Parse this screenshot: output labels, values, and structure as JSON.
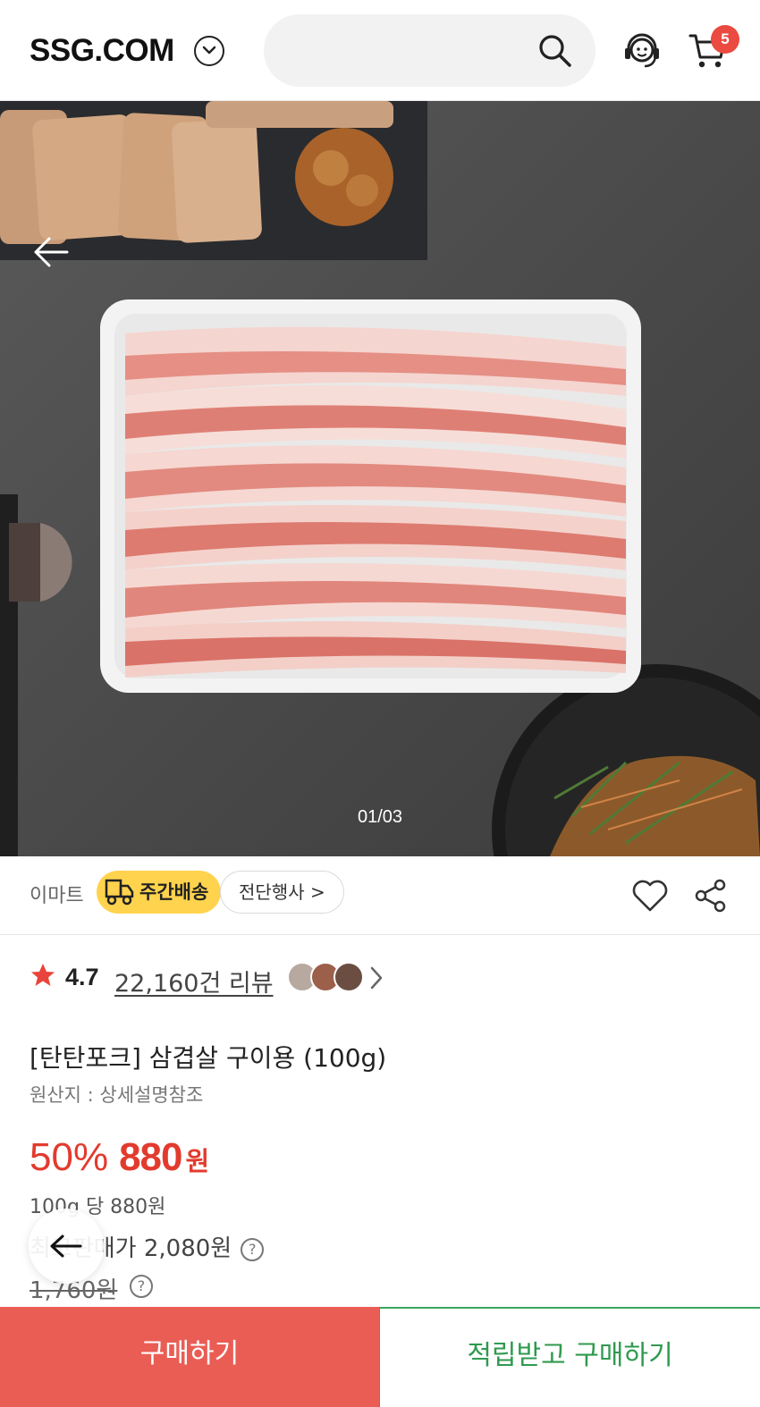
{
  "header": {
    "logo": "SSG.COM",
    "cart_count": "5",
    "icons": [
      "chevron-down-icon",
      "search-icon",
      "customer-service-icon",
      "cart-icon"
    ]
  },
  "gallery": {
    "pager": "01/03"
  },
  "seller": {
    "name": "이마트",
    "delivery_badge": "주간배송",
    "event_badge": "전단행사 >"
  },
  "rating": {
    "value": "4.7",
    "review_link": "22,160건 리뷰"
  },
  "product": {
    "title": "[탄탄포크] 삼겹살 구이용 (100g)",
    "origin": "원산지 : 상세설명참조"
  },
  "price": {
    "discount": "50%",
    "amount": "880",
    "currency": "원",
    "unit_price": "100g 당 880원",
    "best_price": "최고판매가 2,080원",
    "original_price": "1,760원",
    "help_glyph": "?"
  },
  "bottom": {
    "buy_label": "구매하기",
    "save_buy_label": "적립받고 구매하기"
  },
  "colors": {
    "accent_red": "#e23b2e",
    "buy_button": "#ea5d55",
    "save_green": "#2f9a4f",
    "badge_yellow": "#ffd34d"
  }
}
